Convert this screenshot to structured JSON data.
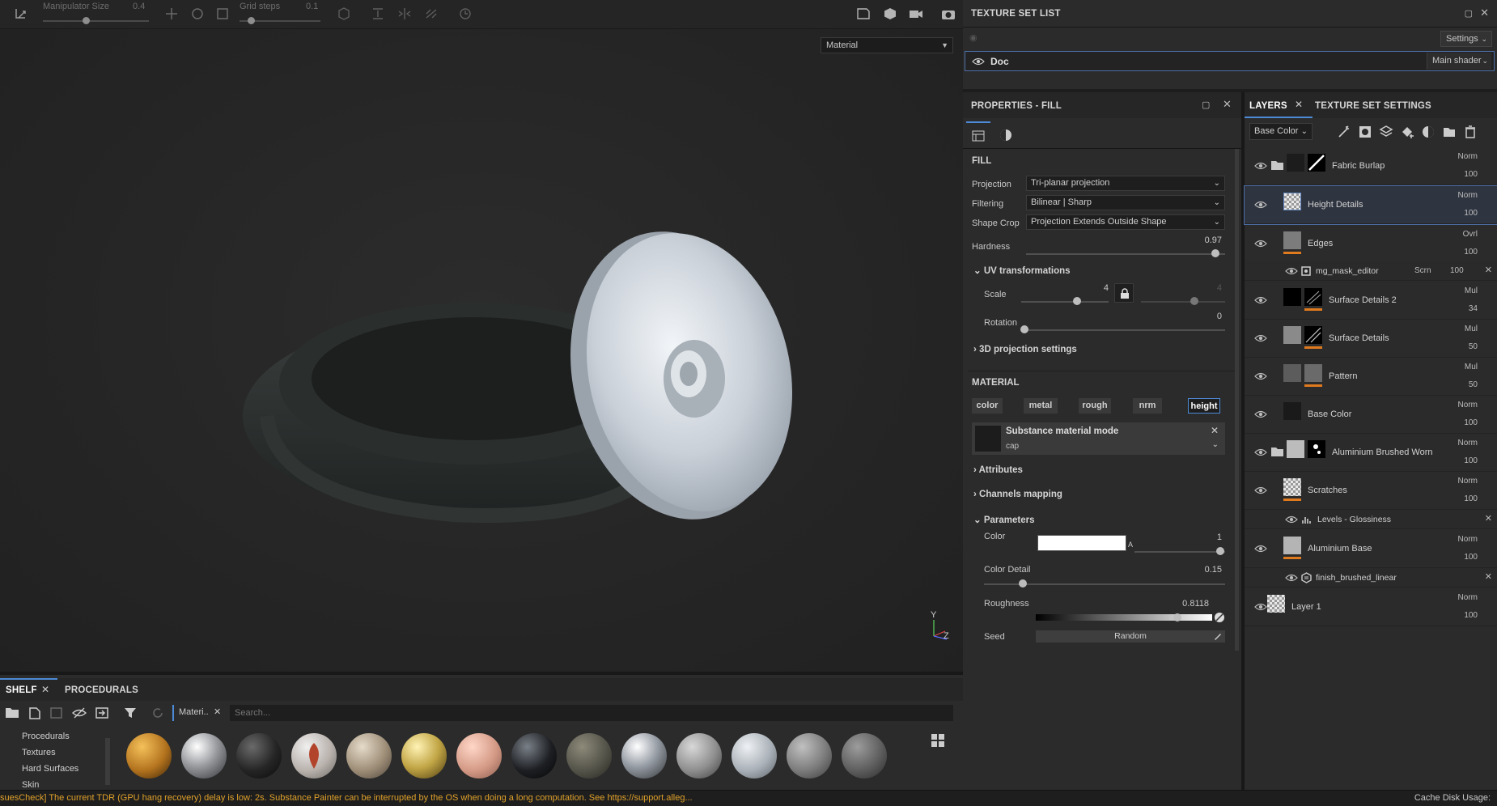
{
  "toolbar": {
    "manipulator_label": "Manipulator Size",
    "manipulator_value": "0.4",
    "grid_label": "Grid steps",
    "grid_value": "0.1"
  },
  "viewport": {
    "mode_select": "Material",
    "axis_y": "Y",
    "axis_z": "Z"
  },
  "texture_set_list": {
    "title": "TEXTURE SET LIST",
    "settings": "Settings",
    "item_name": "Doc",
    "shader": "Main shader"
  },
  "properties": {
    "title": "PROPERTIES - FILL",
    "fill_section": "FILL",
    "projection_label": "Projection",
    "projection_value": "Tri-planar projection",
    "filtering_label": "Filtering",
    "filtering_value": "Bilinear | Sharp",
    "shape_crop_label": "Shape Crop",
    "shape_crop_value": "Projection Extends Outside Shape",
    "hardness_label": "Hardness",
    "hardness_value": "0.97",
    "hardness_level": 0.97,
    "uv_section": "UV transformations",
    "scale_label": "Scale",
    "scale_value": "4",
    "scale_value2": "4",
    "rotation_label": "Rotation",
    "rotation_value": "0",
    "projection3d_section": "3D projection settings",
    "material_section": "MATERIAL",
    "channels": [
      "color",
      "metal",
      "rough",
      "nrm",
      "height"
    ],
    "substance_mode": "Substance material mode",
    "substance_sub": "cap",
    "attributes": "Attributes",
    "channels_mapping": "Channels mapping",
    "parameters": "Parameters",
    "color_label": "Color",
    "color_value": "1",
    "color_swatch": "#ffffff",
    "alpha_label": "A",
    "color_detail_label": "Color Detail",
    "color_detail_value": "0.15",
    "roughness_label": "Roughness",
    "roughness_value": "0.8118",
    "seed_label": "Seed",
    "seed_button": "Random"
  },
  "layers": {
    "tab_layers": "LAYERS",
    "tab_tss": "TEXTURE SET SETTINGS",
    "channel_select": "Base Color",
    "items": [
      {
        "name": "Fabric Burlap",
        "blend": "Norm",
        "opacity": "100"
      },
      {
        "name": "Height Details",
        "blend": "Norm",
        "opacity": "100"
      },
      {
        "name": "Edges",
        "blend": "Ovrl",
        "opacity": "100"
      },
      {
        "name": "Surface Details 2",
        "blend": "Mul",
        "opacity": "34"
      },
      {
        "name": "Surface Details",
        "blend": "Mul",
        "opacity": "50"
      },
      {
        "name": "Pattern",
        "blend": "Mul",
        "opacity": "50"
      },
      {
        "name": "Base Color",
        "blend": "Norm",
        "opacity": "100"
      },
      {
        "name": "Aluminium Brushed Worn",
        "blend": "Norm",
        "opacity": "100"
      },
      {
        "name": "Scratches",
        "blend": "Norm",
        "opacity": "100"
      },
      {
        "name": "Aluminium Base",
        "blend": "Norm",
        "opacity": "100"
      },
      {
        "name": "Layer 1",
        "blend": "Norm",
        "opacity": "100"
      }
    ],
    "sub_mask": {
      "name": "mg_mask_editor",
      "blend": "Scrn",
      "opacity": "100"
    },
    "sub_levels": {
      "name": "Levels - Glossiness"
    },
    "sub_finish": {
      "name": "finish_brushed_linear"
    }
  },
  "shelf": {
    "tab_shelf": "SHELF",
    "tab_procedurals": "PROCEDURALS",
    "filter_chip": "Materi..",
    "search_placeholder": "Search...",
    "categories": [
      "Procedurals",
      "Textures",
      "Hard Surfaces",
      "Skin"
    ]
  },
  "status": {
    "message": "suesCheck] The current TDR (GPU hang recovery) delay is low: 2s. Substance Painter can be interrupted by the OS when doing a long computation. See https://support.alleg...",
    "cache": "Cache Disk Usage:"
  }
}
